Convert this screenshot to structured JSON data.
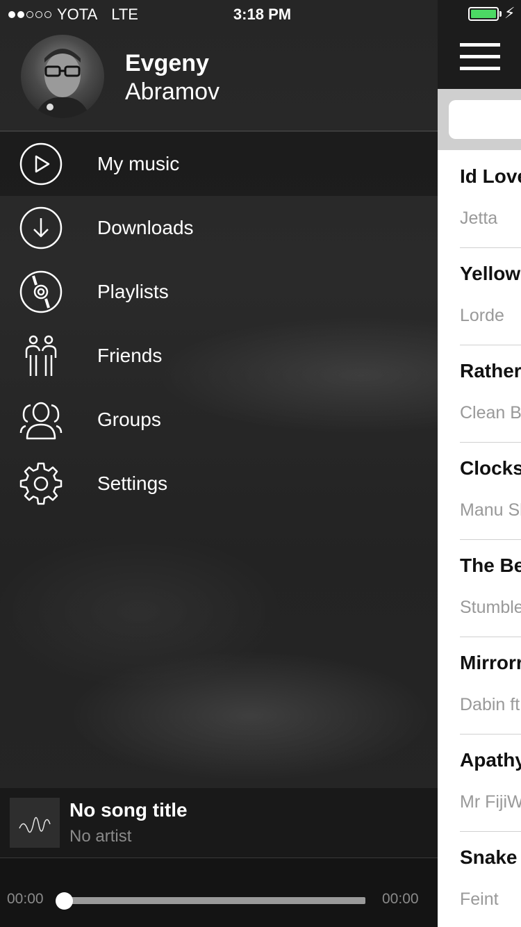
{
  "status_bar": {
    "carrier": "YOTA",
    "network": "LTE",
    "time": "3:18 PM",
    "signal_bars_filled": 2,
    "signal_bars_total": 5,
    "battery_color": "#4cd964",
    "charging": true
  },
  "profile": {
    "first_name": "Evgeny",
    "last_name": "Abramov"
  },
  "menu": {
    "items": [
      {
        "label": "My music",
        "icon": "play-circle-icon",
        "active": true
      },
      {
        "label": "Downloads",
        "icon": "download-circle-icon",
        "active": false
      },
      {
        "label": "Playlists",
        "icon": "disc-icon",
        "active": false
      },
      {
        "label": "Friends",
        "icon": "friends-icon",
        "active": false
      },
      {
        "label": "Groups",
        "icon": "group-icon",
        "active": false
      },
      {
        "label": "Settings",
        "icon": "gear-icon",
        "active": false
      }
    ]
  },
  "player": {
    "title": "No song title",
    "artist": "No artist",
    "elapsed": "00:00",
    "duration": "00:00",
    "progress": 0
  },
  "song_list": {
    "items": [
      {
        "title": "Id Love",
        "artist": "Jetta"
      },
      {
        "title": "Yellow",
        "artist": "Lorde"
      },
      {
        "title": "Rather",
        "artist": "Clean B"
      },
      {
        "title": "Clocks",
        "artist": "Manu Sl"
      },
      {
        "title": "The Be",
        "artist": "Stumble"
      },
      {
        "title": "Mirrorr",
        "artist": "Dabin ft"
      },
      {
        "title": "Apathy",
        "artist": "Mr FijiW"
      },
      {
        "title": "Snake",
        "artist": "Feint"
      }
    ]
  }
}
